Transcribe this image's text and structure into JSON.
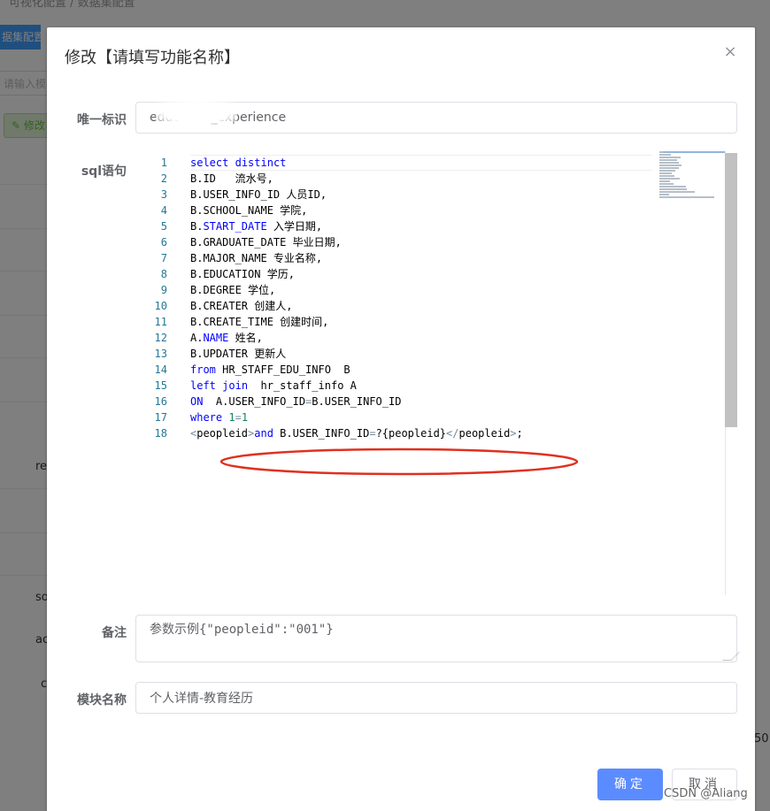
{
  "background": {
    "breadcrumb": "可视化配置 / 数据集配置",
    "tab_label": "据集配置",
    "search_placeholder": "请输入模",
    "edit_button": "修改",
    "cells": [
      "re",
      "so",
      "ac",
      "c"
    ],
    "right_value": "50"
  },
  "dialog": {
    "title": "修改【请填写功能名称】",
    "close_label": "×"
  },
  "form": {
    "id_label": "唯一标识",
    "id_value": "education_experience",
    "sql_label": "sql语句",
    "remark_label": "备注",
    "remark_value": "参数示例{\"peopleid\":\"001\"}",
    "module_label": "模块名称",
    "module_value": "个人详情-教育经历"
  },
  "sql_lines": [
    "select distinct",
    "B.ID   流水号,",
    "B.USER_INFO_ID 人员ID,",
    "B.SCHOOL_NAME 学院,",
    "B.START_DATE 入学日期,",
    "B.GRADUATE_DATE 毕业日期,",
    "B.MAJOR_NAME 专业名称,",
    "B.EDUCATION 学历,",
    "B.DEGREE 学位,",
    "B.CREATER 创建人,",
    "B.CREATE_TIME 创建时间,",
    "A.NAME 姓名,",
    "B.UPDATER 更新人",
    "from HR_STAFF_EDU_INFO  B",
    "left join  hr_staff_info A",
    "ON  A.USER_INFO_ID=B.USER_INFO_ID",
    "where 1=1",
    "<peopleid>and B.USER_INFO_ID=?{peopleid}</peopleid>;"
  ],
  "annotation_color": "#e0301e",
  "buttons": {
    "confirm": "确定",
    "cancel": "取消"
  },
  "watermark": "CSDN @Aliang"
}
